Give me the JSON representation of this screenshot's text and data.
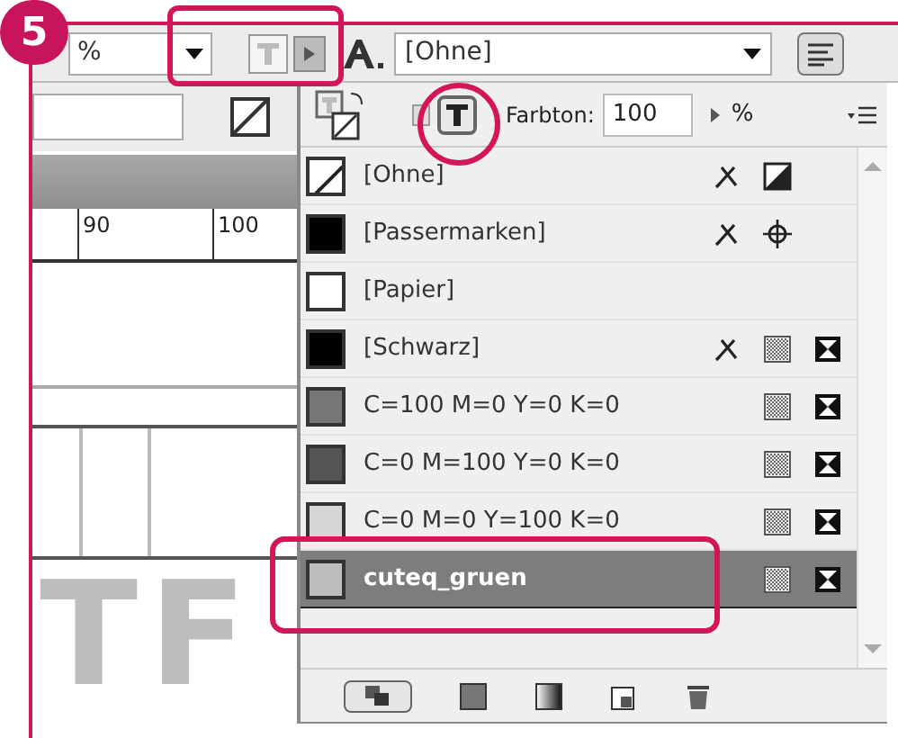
{
  "step_badge": "5",
  "toolbar": {
    "zoom_unit": "%",
    "char_style": "[Ohne]"
  },
  "panel": {
    "tint_label": "Farbton:",
    "tint_value": "100",
    "tint_unit": "%",
    "swatches": [
      {
        "name": "[Ohne]",
        "color": "#ffffff",
        "kind": "none",
        "locked": true,
        "selected": false
      },
      {
        "name": "[Passermarken]",
        "color": "#000000",
        "kind": "registration",
        "locked": true,
        "selected": false
      },
      {
        "name": "[Papier]",
        "color": "#ffffff",
        "kind": "paper",
        "locked": false,
        "selected": false
      },
      {
        "name": "[Schwarz]",
        "color": "#000000",
        "kind": "process",
        "locked": true,
        "selected": false
      },
      {
        "name": "C=100 M=0 Y=0 K=0",
        "color": "#777777",
        "kind": "process",
        "locked": false,
        "selected": false
      },
      {
        "name": "C=0 M=100 Y=0 K=0",
        "color": "#555555",
        "kind": "process",
        "locked": false,
        "selected": false
      },
      {
        "name": "C=0 M=0 Y=100 K=0",
        "color": "#d6d6d6",
        "kind": "process",
        "locked": false,
        "selected": false
      },
      {
        "name": "cuteq_gruen",
        "color": "#bdbdbd",
        "kind": "process",
        "locked": false,
        "selected": true
      }
    ]
  },
  "ruler": {
    "labels": [
      "90",
      "100"
    ]
  },
  "document_text": "TF"
}
